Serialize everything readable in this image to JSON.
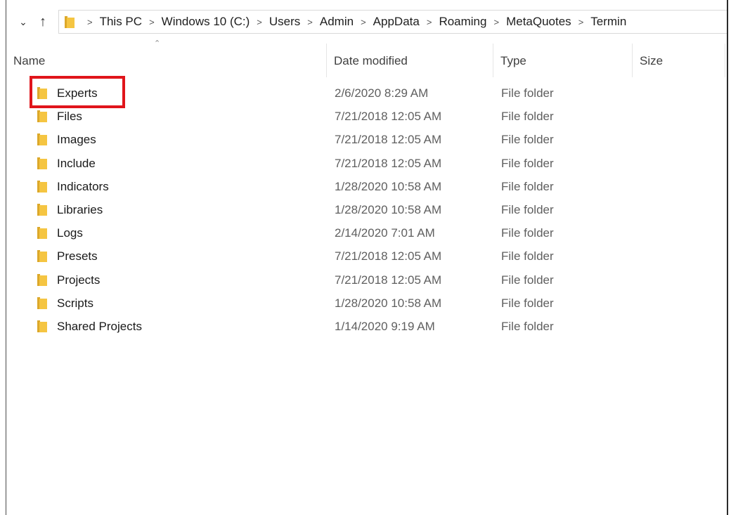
{
  "address_bar": {
    "crumbs": [
      "This PC",
      "Windows 10 (C:)",
      "Users",
      "Admin",
      "AppData",
      "Roaming",
      "MetaQuotes",
      "Termin"
    ]
  },
  "columns": {
    "name": "Name",
    "date": "Date modified",
    "type": "Type",
    "size": "Size"
  },
  "files": [
    {
      "name": "Experts",
      "date": "2/6/2020 8:29 AM",
      "type": "File folder"
    },
    {
      "name": "Files",
      "date": "7/21/2018 12:05 AM",
      "type": "File folder"
    },
    {
      "name": "Images",
      "date": "7/21/2018 12:05 AM",
      "type": "File folder"
    },
    {
      "name": "Include",
      "date": "7/21/2018 12:05 AM",
      "type": "File folder"
    },
    {
      "name": "Indicators",
      "date": "1/28/2020 10:58 AM",
      "type": "File folder"
    },
    {
      "name": "Libraries",
      "date": "1/28/2020 10:58 AM",
      "type": "File folder"
    },
    {
      "name": "Logs",
      "date": "2/14/2020 7:01 AM",
      "type": "File folder"
    },
    {
      "name": "Presets",
      "date": "7/21/2018 12:05 AM",
      "type": "File folder"
    },
    {
      "name": "Projects",
      "date": "7/21/2018 12:05 AM",
      "type": "File folder"
    },
    {
      "name": "Scripts",
      "date": "1/28/2020 10:58 AM",
      "type": "File folder"
    },
    {
      "name": "Shared Projects",
      "date": "1/14/2020 9:19 AM",
      "type": "File folder"
    }
  ],
  "icons": {
    "folder": "folder-icon",
    "nav_down": "chevron-down-icon",
    "nav_up": "arrow-up-icon",
    "sort": "sort-ascending-icon"
  },
  "colors": {
    "folder_fill": "#f5c542",
    "folder_dark": "#dca82a",
    "highlight": "#e0151b"
  }
}
